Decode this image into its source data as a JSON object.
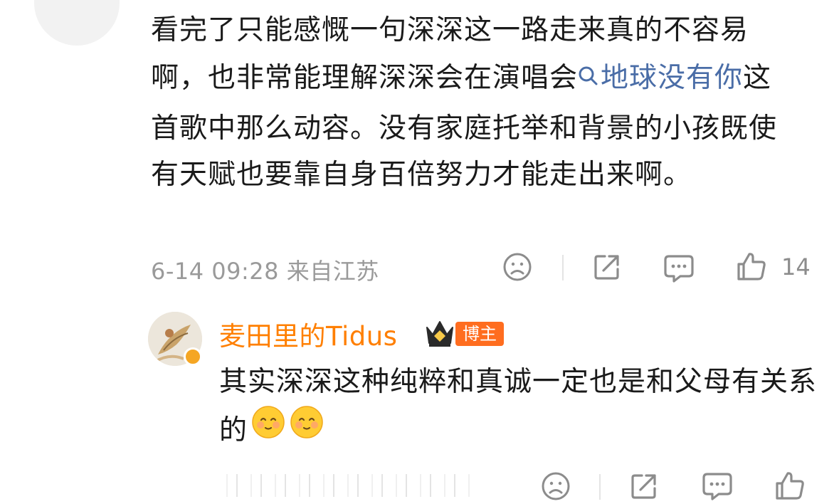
{
  "comment": {
    "text_before": "看完了只能感慨一句深深这一路走来真的不容易啊，也非常能理解深深会在演唱会",
    "link": "地球没有你",
    "text_after": "这首歌中那么动容。没有家庭托举和背景的小孩既使有天赋也要靠自身百倍努力才能走出来啊。",
    "timestamp": "6-14 09:28",
    "location": "来自江苏",
    "like_count": "14"
  },
  "reply": {
    "username": "麦田里的Tidus",
    "tag": "博主",
    "text": "其实深深这种纯粹和真诚一定也是和父母有关系的",
    "emoji_count": 2
  },
  "colors": {
    "link": "#4a6da7",
    "username": "#ff7f00",
    "tag_bg": "#ff6d1f",
    "meta": "#9a9a9a"
  },
  "icons": [
    "search-icon",
    "sad-face-icon",
    "share-icon",
    "comment-icon",
    "like-icon",
    "crown-icon",
    "verified-icon",
    "blush-emoji-icon"
  ]
}
